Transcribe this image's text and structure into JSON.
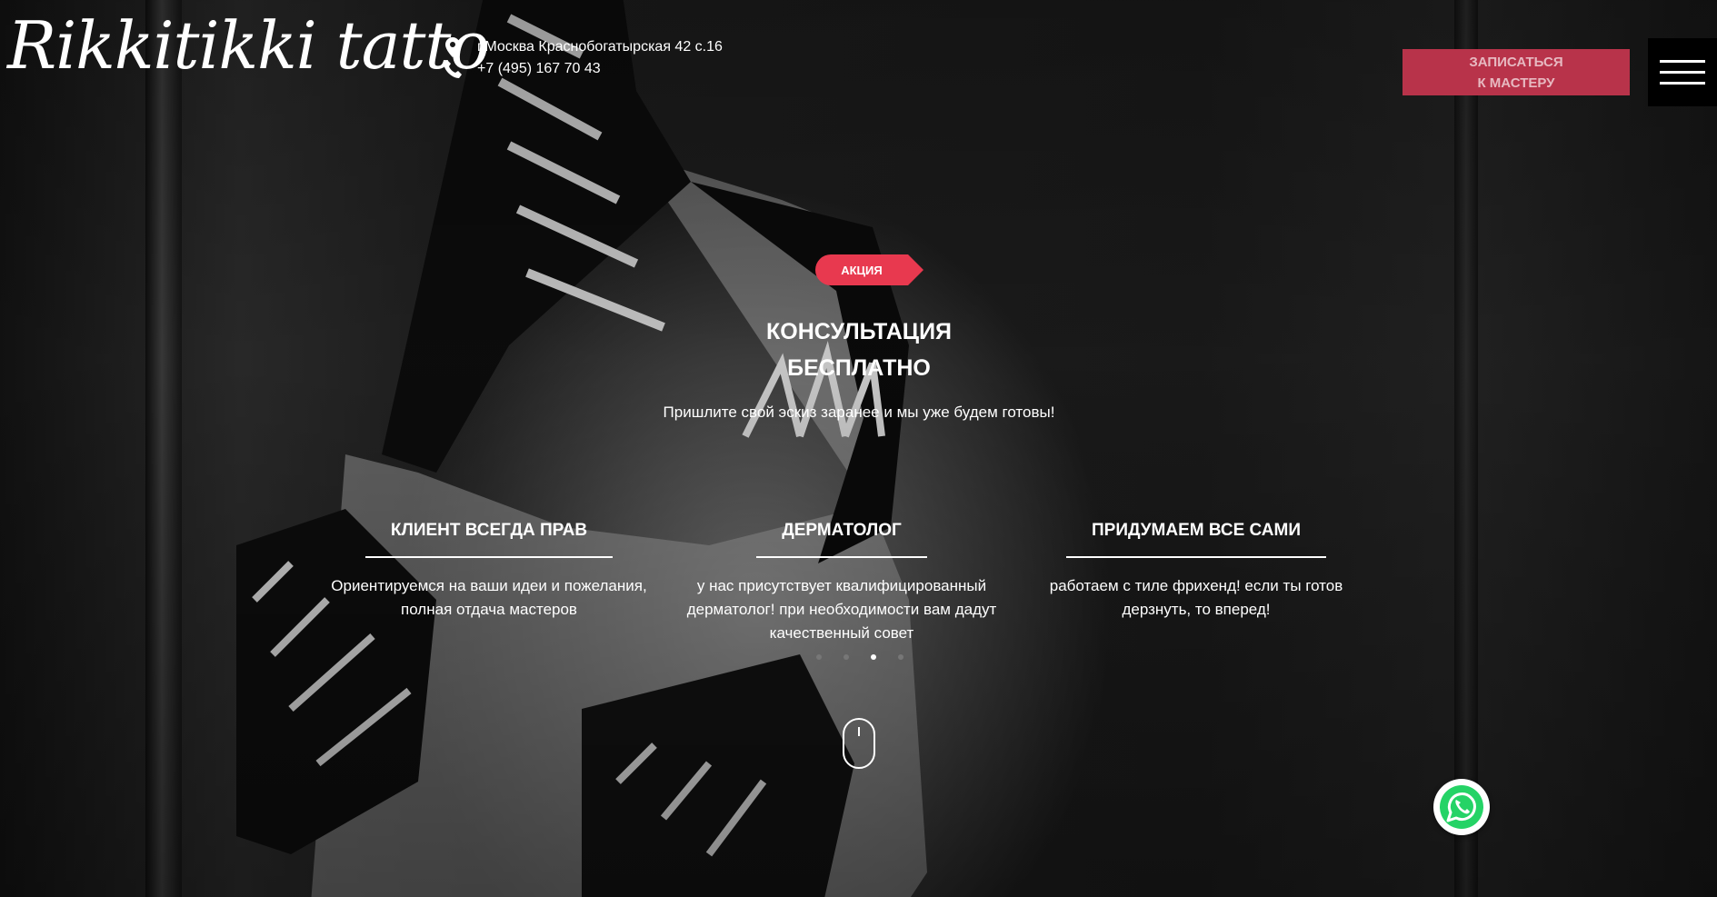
{
  "header": {
    "logo": "Rikkitikki tatto",
    "address": "г.Москва Краснобогатырская 42 с.16",
    "phone": "+7 (495) 167 70 43",
    "book_line1": "ЗАПИСАТЬСЯ",
    "book_line2": "К МАСТЕРУ"
  },
  "promo": {
    "badge": "АКЦИЯ",
    "title_line1": "КОНСУЛЬТАЦИЯ",
    "title_line2": "БЕСПЛАТНО",
    "subtitle": "Пришлите свой эскиз заранее и мы уже будем готовы!"
  },
  "features": [
    {
      "title": "КЛИЕНТ ВСЕГДА ПРАВ",
      "text": "Ориентируемся на ваши идеи и пожелания, полная отдача мастеров"
    },
    {
      "title": "ДЕРМАТОЛОГ",
      "text": "у нас присутствует квалифицированный дерматолог! при необходимости вам дадут качественный совет"
    },
    {
      "title": "ПРИДУМАЕМ ВСЕ САМИ",
      "text": "работаем с тиле фрихенд! если ты готов дерзнуть, то вперед!"
    }
  ],
  "slider": {
    "total": 4,
    "active_index": 2
  },
  "icons": {
    "address": "location-pin-icon",
    "phone": "phone-icon",
    "menu": "hamburger-menu-icon",
    "scroll": "mouse-scroll-icon",
    "whatsapp": "whatsapp-icon"
  },
  "colors": {
    "accent": "#e8394f",
    "button": "#b8334a",
    "whatsapp": "#25d366"
  }
}
